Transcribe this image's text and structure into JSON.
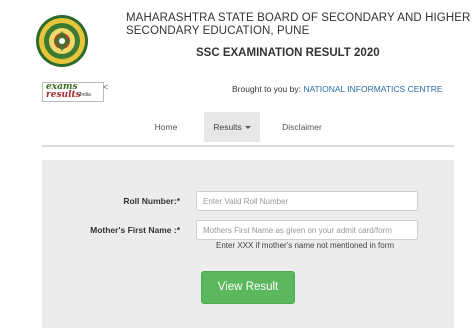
{
  "header": {
    "board_title": "MAHARASHTRA STATE BOARD OF SECONDARY AND HIGHER SECONDARY EDUCATION, PUNE",
    "result_title": "SSC EXAMINATION RESULT 2020"
  },
  "sponsor": {
    "logo_line1": "exams",
    "logo_line2": "results",
    "logo_line3": "India",
    "logo_trailing": "<",
    "brought_prefix": "Brought to you by: ",
    "brought_name": "NATIONAL INFORMATICS CENTRE"
  },
  "nav": {
    "home": "Home",
    "results": "Results",
    "disclaimer": "Disclaimer"
  },
  "form": {
    "roll_label": "Roll Number:*",
    "roll_placeholder": "Enter Valid Roll Number",
    "roll_value": "",
    "mother_label": "Mother's First Name :*",
    "mother_placeholder": "Mothers First Name as given on your admit card/form",
    "mother_value": "",
    "hint": "Enter XXX if mother's name not mentioned in form",
    "submit_label": "View Result"
  },
  "colors": {
    "submit_green": "#5cb85c",
    "link_blue": "#2a6fa8",
    "panel_gray": "#ececec"
  }
}
